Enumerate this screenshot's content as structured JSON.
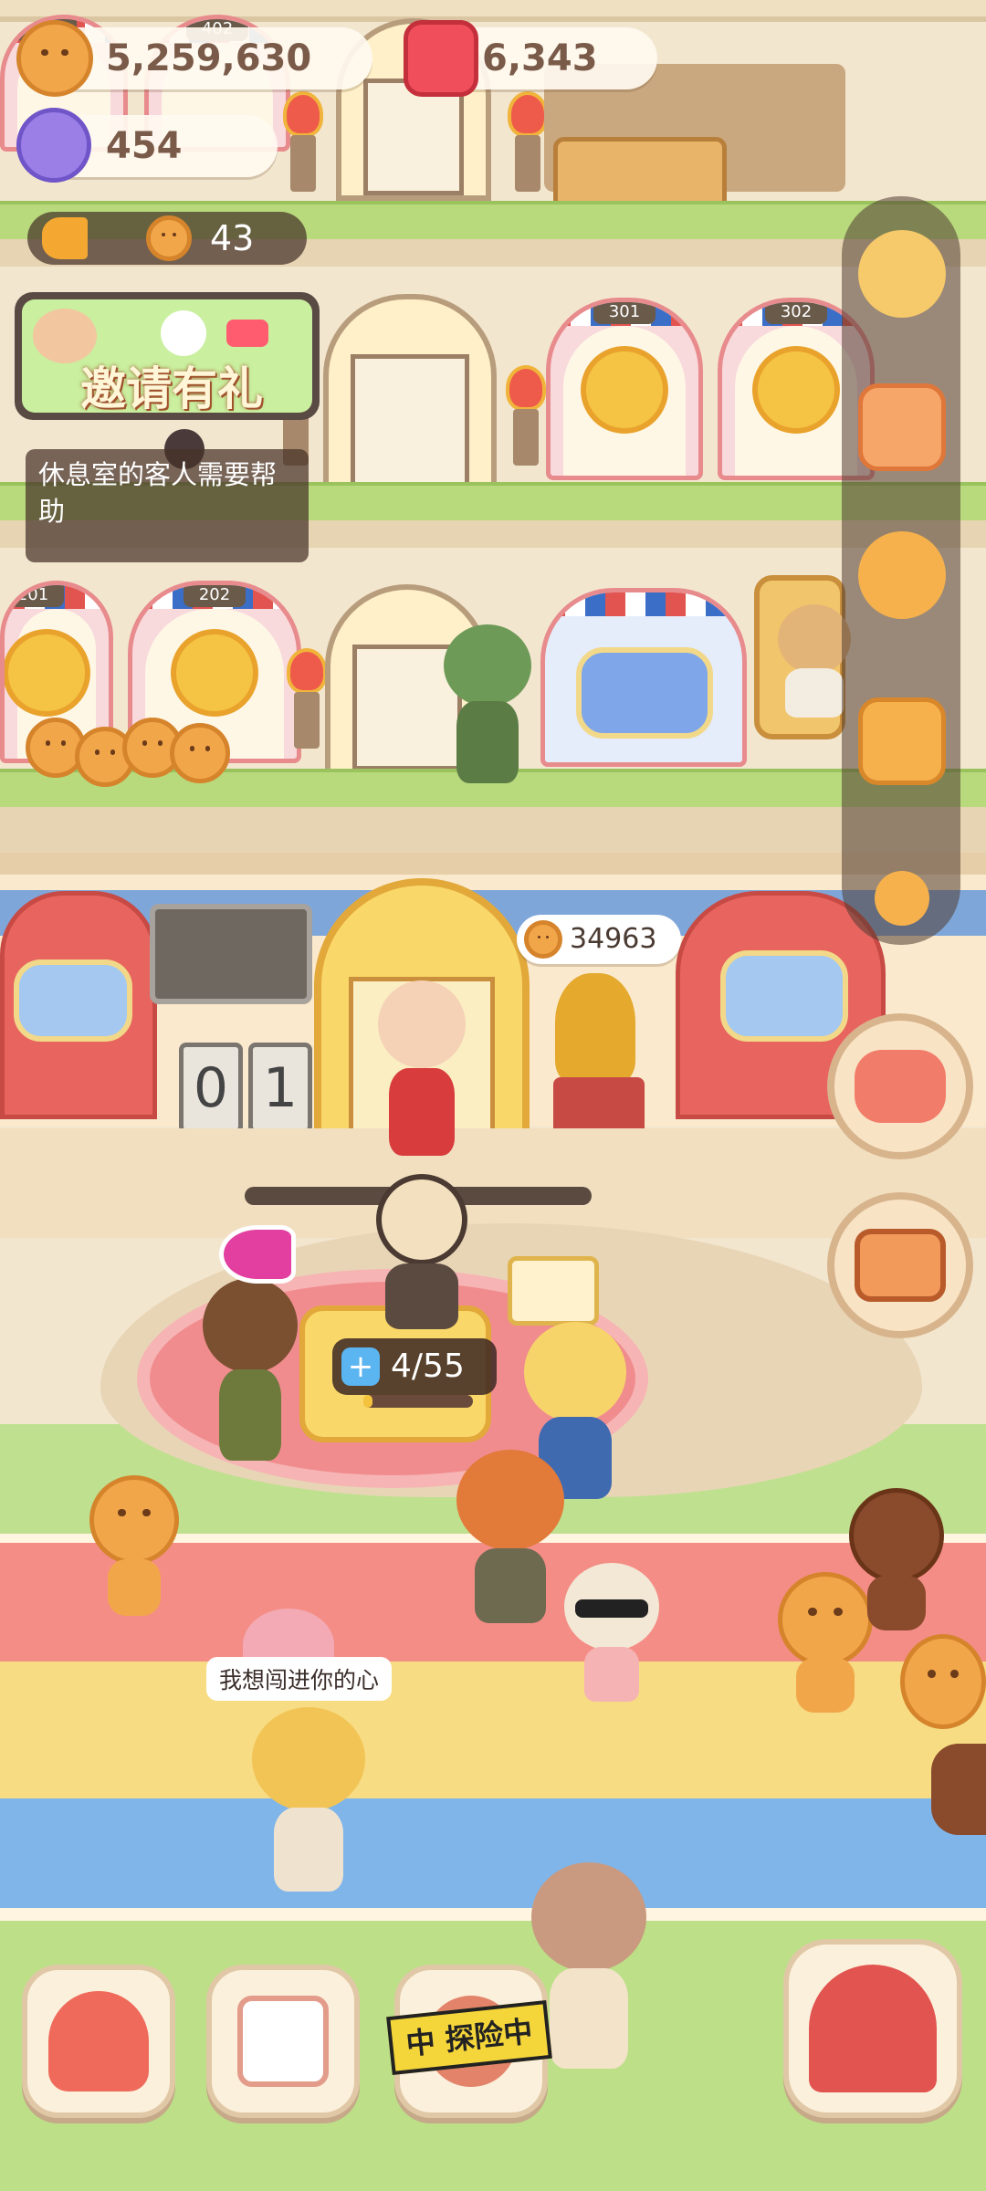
{
  "hud": {
    "coins": "5,259,630",
    "gems": "6,343",
    "candy": "454",
    "cookie_count": "43"
  },
  "invite_banner": {
    "label": "邀请有礼"
  },
  "notice": {
    "text": "休息室的客人需要帮助"
  },
  "rooms": {
    "floor3": [
      "301",
      "302"
    ],
    "floor2": [
      "201",
      "202"
    ]
  },
  "trophy_score": "34963",
  "flip_counter": [
    "0",
    "1"
  ],
  "reception_progress": "4/55",
  "speech_bubble": "我想闯进你的心",
  "explore_tag": "中 探险中",
  "colors": {
    "coral": "#e88b8d",
    "gold": "#f5c445",
    "cookie": "#f2a64a",
    "hud_text": "#7a5a48",
    "dark_overlay": "#463228"
  },
  "icons": {
    "settings": "gear-icon",
    "profile": "id-card-icon",
    "achievements": "star-medal-icon",
    "inventory": "backpack-icon",
    "friends": "friends-icon",
    "events": "party-icon",
    "tv": "tv-icon",
    "home": "mushroom-house-icon",
    "calendar": "calendar-heart-icon",
    "circus": "circus-tent-icon"
  }
}
